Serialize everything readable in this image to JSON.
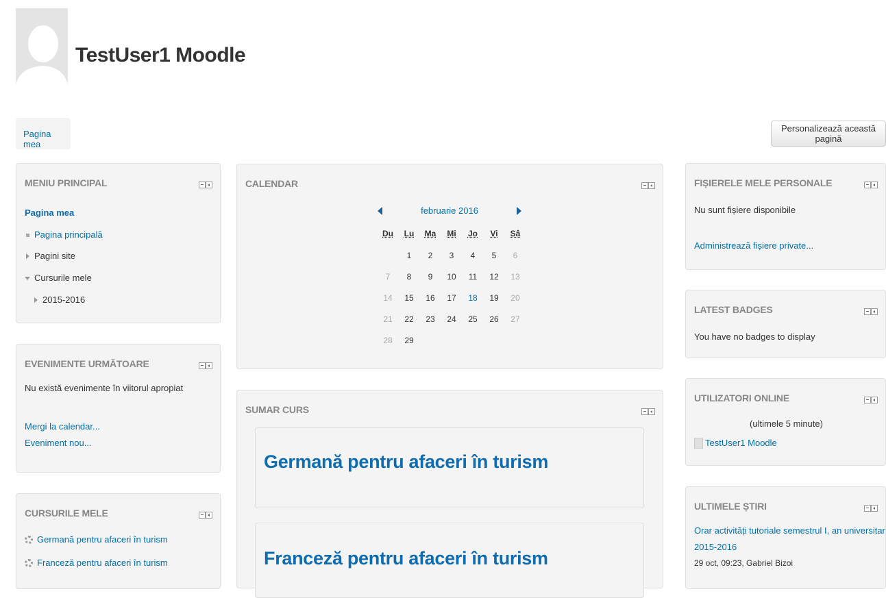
{
  "header": {
    "user_name": "TestUser1 Moodle",
    "nav_pill": "Pagina mea",
    "customize_button": "Personalizează această pagină"
  },
  "main_menu": {
    "title": "MENIU PRINCIPAL",
    "current": "Pagina mea",
    "items": [
      "Pagina principală",
      "Pagini site",
      "Cursurile mele",
      "2015-2016"
    ]
  },
  "upcoming_events": {
    "title": "EVENIMENTE URMĂTOARE",
    "empty_text": "Nu există evenimente în viitorul apropiat",
    "goto_calendar": "Mergi la calendar...",
    "new_event": "Eveniment nou..."
  },
  "my_courses": {
    "title": "CURSURILE MELE",
    "items": [
      "Germană pentru afaceri în turism",
      "Franceză pentru afaceri în turism"
    ]
  },
  "calendar": {
    "title": "CALENDAR",
    "month": "februarie 2016",
    "weekdays": [
      "Du",
      "Lu",
      "Ma",
      "Mi",
      "Jo",
      "Vi",
      "Sâ"
    ],
    "rows": [
      [
        "",
        "1",
        "2",
        "3",
        "4",
        "5",
        "6"
      ],
      [
        "7",
        "8",
        "9",
        "10",
        "11",
        "12",
        "13"
      ],
      [
        "14",
        "15",
        "16",
        "17",
        "18",
        "19",
        "20"
      ],
      [
        "21",
        "22",
        "23",
        "24",
        "25",
        "26",
        "27"
      ],
      [
        "28",
        "29",
        "",
        "",
        "",
        "",
        ""
      ]
    ],
    "today": "18",
    "colors": {
      "weekend": "#aaaaaa",
      "today": "#0070a8",
      "arrow": "#1f5e93"
    }
  },
  "course_summary": {
    "title": "SUMAR CURS",
    "courses": [
      "Germană pentru afaceri în turism",
      "Franceză pentru afaceri în turism"
    ]
  },
  "private_files": {
    "title": "FIȘIERELE MELE PERSONALE",
    "empty_text": "Nu sunt fișiere disponibile",
    "manage_link": "Administrează fișiere private..."
  },
  "latest_badges": {
    "title": "LATEST BADGES",
    "empty_text": "You have no badges to display"
  },
  "online_users": {
    "title": "UTILIZATORI ONLINE",
    "period": "(ultimele 5 minute)",
    "users": [
      "TestUser1 Moodle"
    ]
  },
  "latest_news": {
    "title": "ULTIMELE ȘTIRI",
    "headline_line1": "Orar activități tutoriale semestrul I, an universitar",
    "headline_line2": "2015-2016",
    "meta": "29 oct, 09:23, Gabriel Bizoi"
  },
  "icons": {
    "block_controls": "block-hide-dock-icon",
    "tree_leaf": "square-bullet-icon",
    "tree_collapsed": "triangle-right-icon",
    "tree_expanded": "triangle-down-icon",
    "course": "course-icon",
    "user": "user-avatar-icon"
  },
  "colors": {
    "link": "#0070a8",
    "course_heading": "#0f6cae",
    "block_bg": "#f4f4f4",
    "block_title": "#888888"
  }
}
